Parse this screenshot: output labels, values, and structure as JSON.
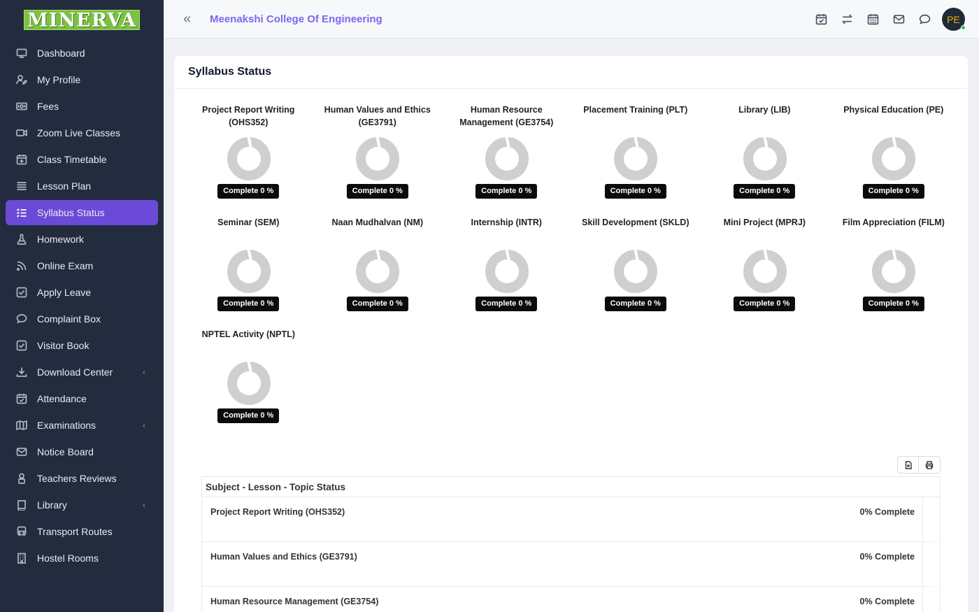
{
  "brand": {
    "logo_text": "MINERVA",
    "accent": "#6a4ad6",
    "logo_green": "#7cc241"
  },
  "sidebar": {
    "items": [
      {
        "label": "Dashboard",
        "icon": "monitor-icon",
        "active": false,
        "has_submenu": false
      },
      {
        "label": "My Profile",
        "icon": "user-edit-icon",
        "active": false,
        "has_submenu": false
      },
      {
        "label": "Fees",
        "icon": "money-icon",
        "active": false,
        "has_submenu": false
      },
      {
        "label": "Zoom Live Classes",
        "icon": "video-icon",
        "active": false,
        "has_submenu": false
      },
      {
        "label": "Class Timetable",
        "icon": "calendar-plus-icon",
        "active": false,
        "has_submenu": false
      },
      {
        "label": "Lesson Plan",
        "icon": "list-lines-icon",
        "active": false,
        "has_submenu": false
      },
      {
        "label": "Syllabus Status",
        "icon": "list-check-icon",
        "active": true,
        "has_submenu": false
      },
      {
        "label": "Homework",
        "icon": "flask-icon",
        "active": false,
        "has_submenu": false
      },
      {
        "label": "Online Exam",
        "icon": "rss-icon",
        "active": false,
        "has_submenu": false
      },
      {
        "label": "Apply Leave",
        "icon": "check-square-icon",
        "active": false,
        "has_submenu": false
      },
      {
        "label": "Complaint Box",
        "icon": "chat-bubble-icon",
        "active": false,
        "has_submenu": false
      },
      {
        "label": "Visitor Book",
        "icon": "check-square-icon",
        "active": false,
        "has_submenu": false
      },
      {
        "label": "Download Center",
        "icon": "download-icon",
        "active": false,
        "has_submenu": true
      },
      {
        "label": "Attendance",
        "icon": "calendar-check-icon",
        "active": false,
        "has_submenu": false
      },
      {
        "label": "Examinations",
        "icon": "map-icon",
        "active": false,
        "has_submenu": true
      },
      {
        "label": "Notice Board",
        "icon": "envelope-icon",
        "active": false,
        "has_submenu": false
      },
      {
        "label": "Teachers Reviews",
        "icon": "user-lock-icon",
        "active": false,
        "has_submenu": false
      },
      {
        "label": "Library",
        "icon": "book-icon",
        "active": false,
        "has_submenu": true
      },
      {
        "label": "Transport Routes",
        "icon": "bus-icon",
        "active": false,
        "has_submenu": false
      },
      {
        "label": "Hostel Rooms",
        "icon": "building-icon",
        "active": false,
        "has_submenu": false
      }
    ]
  },
  "header": {
    "college_name": "Meenakshi College Of Engineering",
    "avatar_initials": "PE",
    "tools": [
      "calendar-check-icon",
      "exchange-icon",
      "calendar-icon",
      "envelope-icon",
      "chat-icon"
    ]
  },
  "main": {
    "title": "Syllabus Status",
    "subjects": [
      {
        "title": "Project Report Writing (OHS352)",
        "badge": "Complete 0 %",
        "percent": 0
      },
      {
        "title": "Human Values and Ethics (GE3791)",
        "badge": "Complete 0 %",
        "percent": 0
      },
      {
        "title": "Human Resource Management (GE3754)",
        "badge": "Complete 0 %",
        "percent": 0
      },
      {
        "title": "Placement Training (PLT)",
        "badge": "Complete 0 %",
        "percent": 0
      },
      {
        "title": "Library (LIB)",
        "badge": "Complete 0 %",
        "percent": 0
      },
      {
        "title": "Physical Education (PE)",
        "badge": "Complete 0 %",
        "percent": 0
      },
      {
        "title": "Seminar (SEM)",
        "badge": "Complete 0 %",
        "percent": 0
      },
      {
        "title": "Naan Mudhalvan (NM)",
        "badge": "Complete 0 %",
        "percent": 0
      },
      {
        "title": "Internship (INTR)",
        "badge": "Complete 0 %",
        "percent": 0
      },
      {
        "title": "Skill Development (SKLD)",
        "badge": "Complete 0 %",
        "percent": 0
      },
      {
        "title": "Mini Project (MPRJ)",
        "badge": "Complete 0 %",
        "percent": 0
      },
      {
        "title": "Film Appreciation (FILM)",
        "badge": "Complete 0 %",
        "percent": 0
      },
      {
        "title": "NPTEL Activity (NPTL)",
        "badge": "Complete 0 %",
        "percent": 0
      }
    ],
    "table": {
      "heading": "Subject - Lesson - Topic Status",
      "rows": [
        {
          "subject": "Project Report Writing (OHS352)",
          "status": "0% Complete"
        },
        {
          "subject": "Human Values and Ethics (GE3791)",
          "status": "0% Complete"
        },
        {
          "subject": "Human Resource Management (GE3754)",
          "status": "0% Complete"
        }
      ]
    }
  }
}
